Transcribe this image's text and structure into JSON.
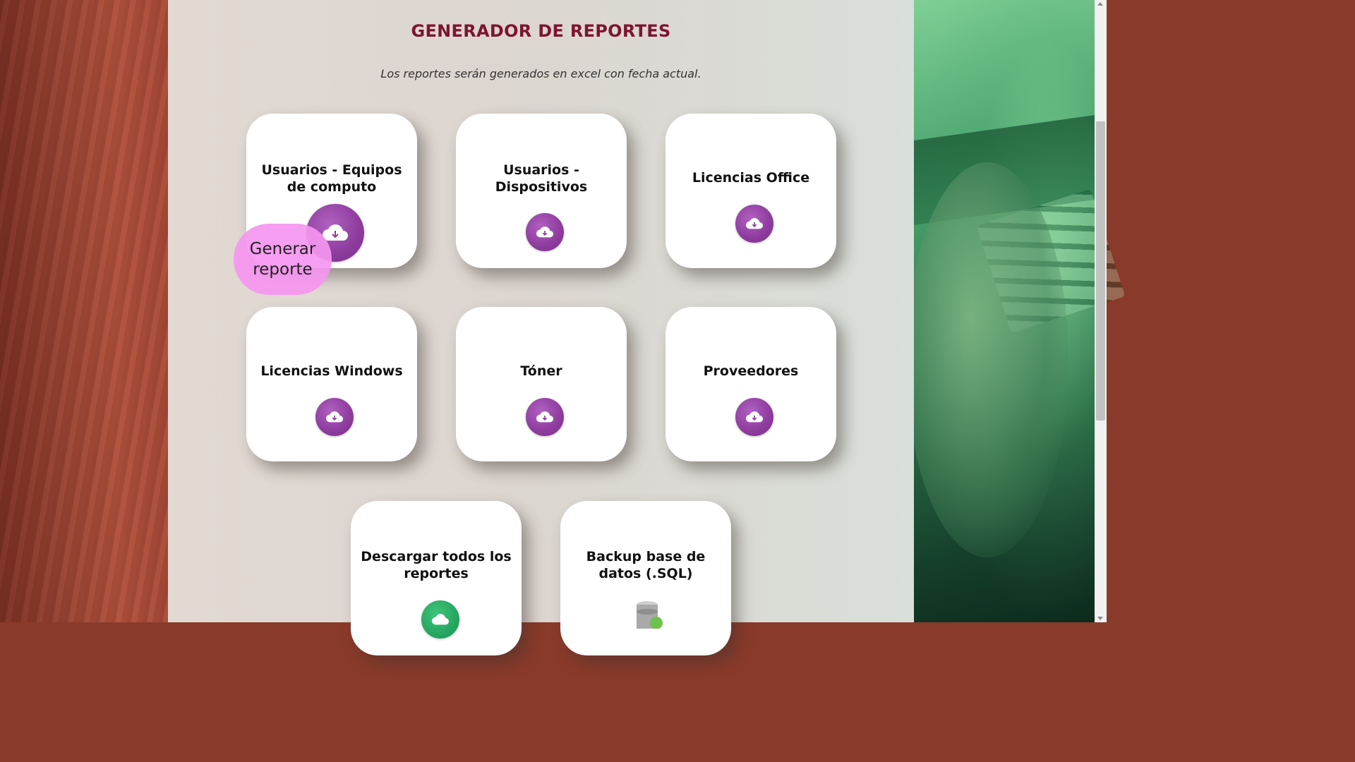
{
  "page": {
    "title": "GENERADOR DE REPORTES",
    "subtitle": "Los reportes serán generados en excel con fecha actual."
  },
  "cards": [
    {
      "title": "Usuarios - Equipos de computo",
      "icon": "cloud-download-icon"
    },
    {
      "title": "Usuarios - Dispositivos",
      "icon": "cloud-download-icon"
    },
    {
      "title": "Licencias Office",
      "icon": "cloud-download-icon"
    },
    {
      "title": "Licencias Windows",
      "icon": "cloud-download-icon"
    },
    {
      "title": "Tóner",
      "icon": "cloud-download-icon"
    },
    {
      "title": "Proveedores",
      "icon": "cloud-download-icon"
    },
    {
      "title": "Descargar todos los reportes",
      "icon": "cloud-download-icon"
    },
    {
      "title": "Backup base de datos (.SQL)",
      "icon": "database-icon"
    }
  ],
  "tooltip": {
    "text": "Generar reporte"
  },
  "colors": {
    "title": "#7d1530",
    "button": "#8d3c9d",
    "tooltip": "#f596f0",
    "green_button": "#22a25c"
  }
}
